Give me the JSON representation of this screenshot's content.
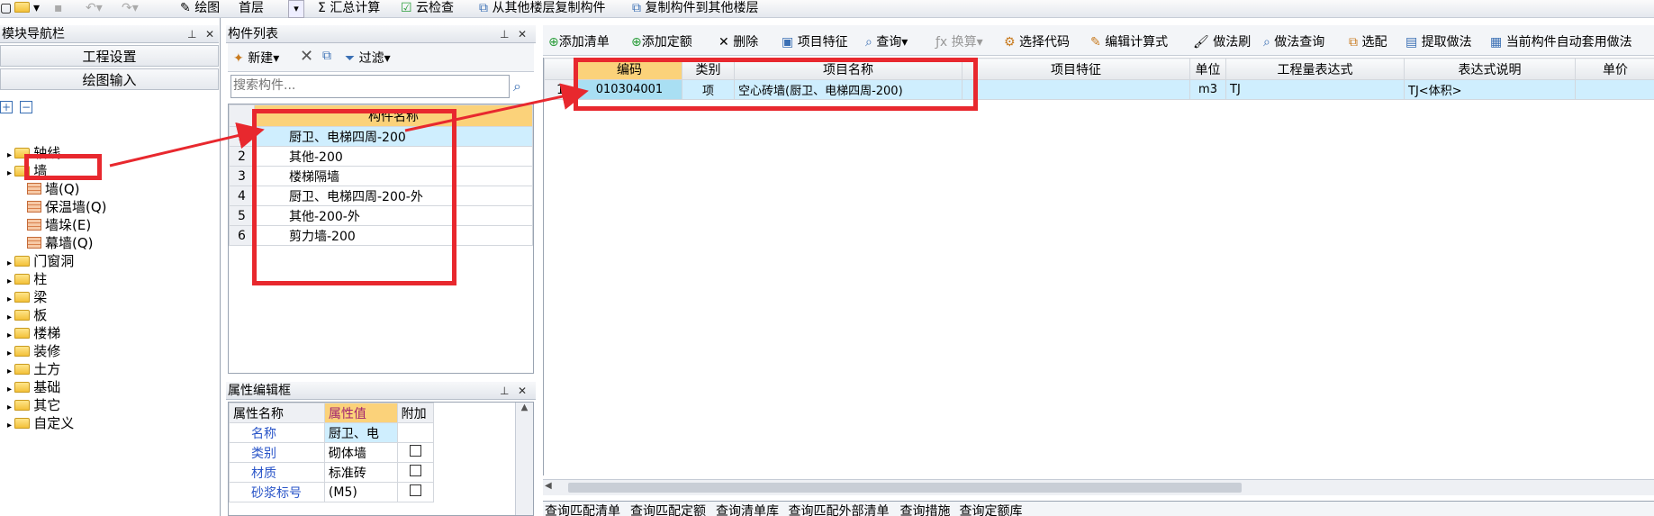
{
  "toolbar": {
    "floor_label": "绘图",
    "floor_value": "首层",
    "sum_calc": "汇总计算",
    "cloud_check": "云检查",
    "copy_from_floor": "从其他楼层复制构件",
    "copy_to_floor": "复制构件到其他楼层"
  },
  "nav": {
    "title": "模块导航栏",
    "btn_project": "工程设置",
    "btn_draw": "绘图输入",
    "tree": [
      {
        "label": "轴线",
        "level": 0
      },
      {
        "label": "墙",
        "level": 0
      },
      {
        "label": "墙(Q)",
        "level": 1
      },
      {
        "label": "保温墙(Q)",
        "level": 1
      },
      {
        "label": "墙垛(E)",
        "level": 1
      },
      {
        "label": "幕墙(Q)",
        "level": 1
      },
      {
        "label": "门窗洞",
        "level": 0
      },
      {
        "label": "柱",
        "level": 0
      },
      {
        "label": "梁",
        "level": 0
      },
      {
        "label": "板",
        "level": 0
      },
      {
        "label": "楼梯",
        "level": 0
      },
      {
        "label": "装修",
        "level": 0
      },
      {
        "label": "土方",
        "level": 0
      },
      {
        "label": "基础",
        "level": 0
      },
      {
        "label": "其它",
        "level": 0
      },
      {
        "label": "自定义",
        "level": 0
      }
    ]
  },
  "clist": {
    "title": "构件列表",
    "new_btn": "新建",
    "filter_btn": "过滤",
    "search_placeholder": "搜索构件...",
    "col_name": "构件名称",
    "rows": [
      {
        "idx": "1",
        "name": "厨卫、电梯四周-200"
      },
      {
        "idx": "2",
        "name": "其他-200"
      },
      {
        "idx": "3",
        "name": "楼梯隔墙"
      },
      {
        "idx": "4",
        "name": "厨卫、电梯四周-200-外"
      },
      {
        "idx": "5",
        "name": "其他-200-外"
      },
      {
        "idx": "6",
        "name": "剪力墙-200"
      }
    ]
  },
  "props": {
    "title": "属性编辑框",
    "col_name": "属性名称",
    "col_value": "属性值",
    "col_extra": "附加",
    "rows": [
      {
        "name": "名称",
        "value": "厨卫、电"
      },
      {
        "name": "类别",
        "value": "砌体墙"
      },
      {
        "name": "材质",
        "value": "标准砖"
      },
      {
        "name": "砂浆标号",
        "value": "(M5)"
      }
    ]
  },
  "rtoolbar": {
    "add_list": "添加清单",
    "add_quota": "添加定额",
    "delete": "删除",
    "item_feature": "项目特征",
    "query": "查询",
    "convert": "换算",
    "select_code": "选择代码",
    "edit_formula": "编辑计算式",
    "method_brush": "做法刷",
    "method_query": "做法查询",
    "select_match": "选配",
    "extract_method": "提取做法",
    "auto_apply": "当前构件自动套用做法"
  },
  "rgrid": {
    "headers": [
      "编码",
      "类别",
      "项目名称",
      "项目特征",
      "单位",
      "工程量表达式",
      "表达式说明",
      "单价"
    ],
    "rows": [
      {
        "idx": "1",
        "code": "010304001",
        "type": "项",
        "name": "空心砖墙(厨卫、电梯四周-200)",
        "feature": "",
        "unit": "m3",
        "expr": "TJ",
        "expr_desc": "TJ<体积>",
        "price": ""
      }
    ]
  },
  "bottom_tabs": [
    "查询匹配清单",
    "查询匹配定额",
    "查询清单库",
    "查询匹配外部清单",
    "查询措施",
    "查询定额库"
  ],
  "colors": {
    "annotation_red": "#e8282e",
    "selected_row": "#cfeefe",
    "header_highlight": "#fbd27a"
  }
}
